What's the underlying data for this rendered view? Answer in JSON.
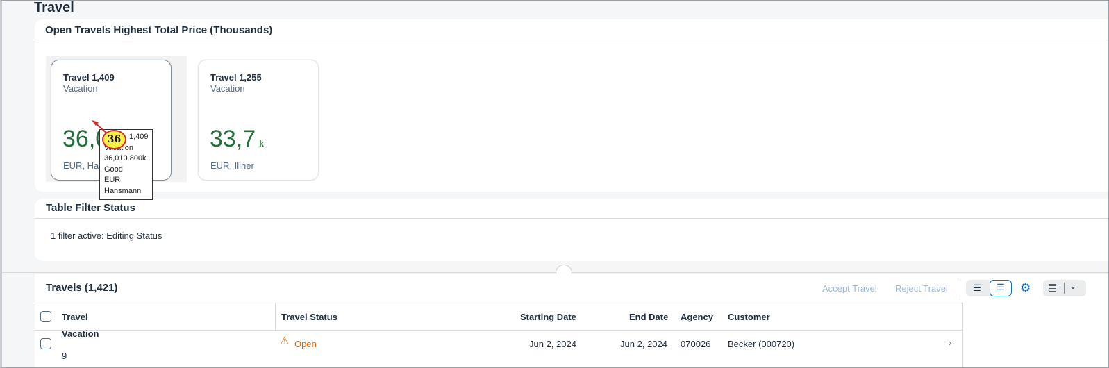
{
  "page": {
    "title": "Travel"
  },
  "kpi_panel": {
    "title": "Open Travels Highest Total Price (Thousands)",
    "cards": [
      {
        "title": "Travel 1,409",
        "subtitle": "Vacation",
        "value": "36,0",
        "unit": "",
        "footer": "EUR, Ha"
      },
      {
        "title": "Travel 1,255",
        "subtitle": "Vacation",
        "value": "33,7",
        "unit": "k",
        "footer": "EUR, Illner"
      }
    ],
    "tooltip": {
      "lines": [
        "1,409",
        "Vacation",
        "36,010.800k",
        "Good",
        "EUR",
        "Hansmann"
      ]
    },
    "marker": "36"
  },
  "filter_panel": {
    "title": "Table Filter Status",
    "text": "1 filter active: Editing Status"
  },
  "table": {
    "title": "Travels (1,421)",
    "toolbar": {
      "accept": "Accept Travel",
      "reject": "Reject Travel"
    },
    "columns": [
      "Travel",
      "Travel Status",
      "Starting Date",
      "End Date",
      "Agency",
      "Customer"
    ],
    "rows": [
      {
        "travel_line1": "Vacation",
        "travel_line2": "9",
        "status": "Open",
        "start": "Jun 2, 2024",
        "end": "Jun 2, 2024",
        "agency": "070026",
        "customer": "Becker (000720)"
      }
    ]
  },
  "colors": {
    "positive": "#256f3a",
    "warning": "#e76500",
    "accent": "#0a6ed1"
  },
  "icons": {
    "collapse": "chevron-down-icon",
    "status": "warning-icon",
    "settings": "gear-icon",
    "export": "export-icon"
  }
}
